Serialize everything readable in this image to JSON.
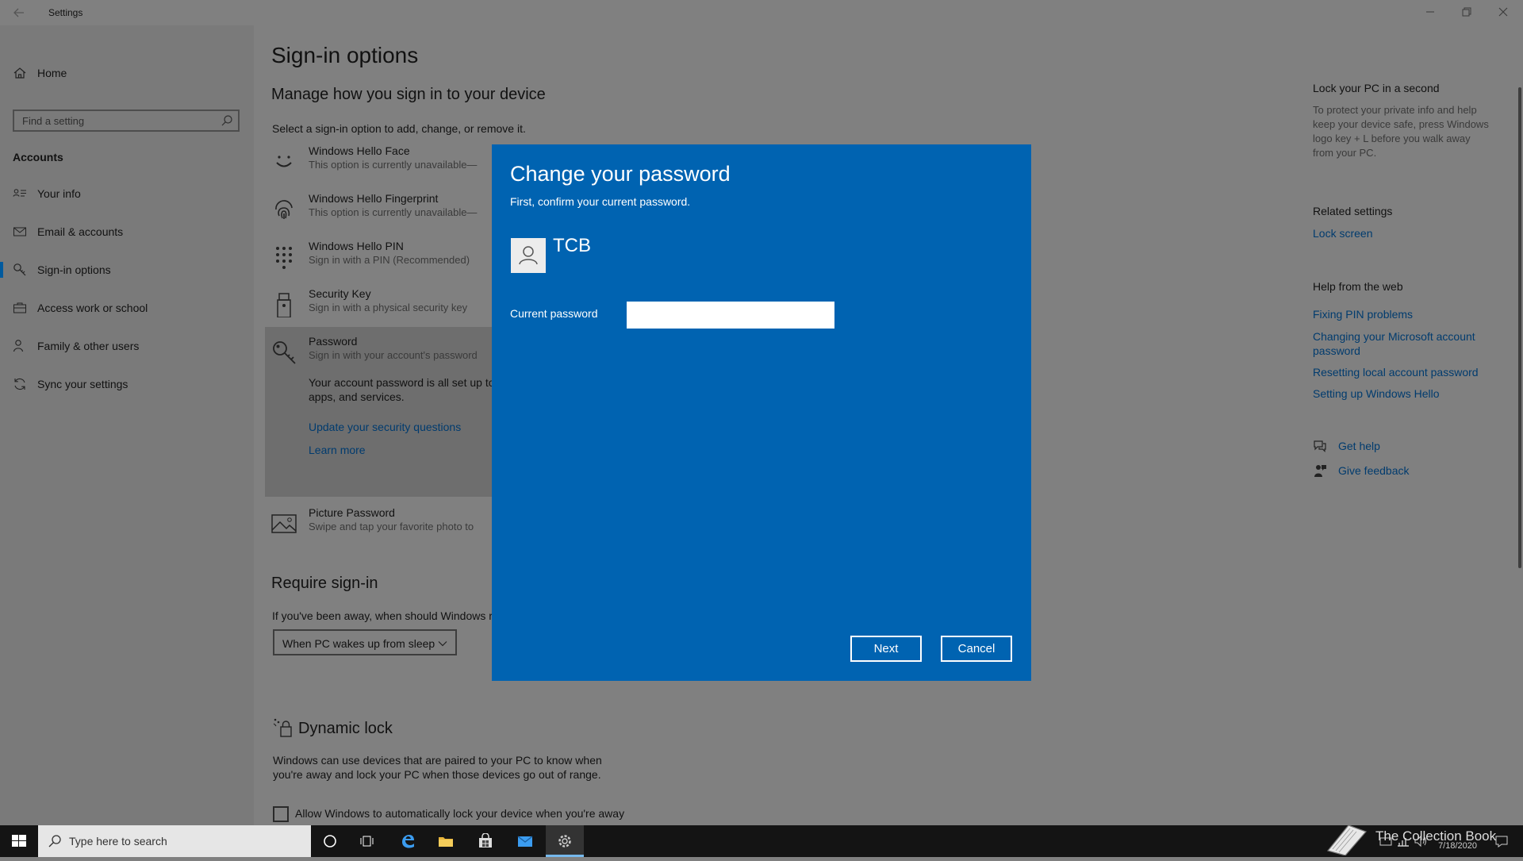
{
  "window": {
    "title": "Settings"
  },
  "sidebar": {
    "home_label": "Home",
    "search_placeholder": "Find a setting",
    "section_label": "Accounts",
    "items": [
      {
        "label": "Your info",
        "icon": "person-card-icon"
      },
      {
        "label": "Email & accounts",
        "icon": "mail-icon"
      },
      {
        "label": "Sign-in options",
        "icon": "key-icon",
        "active": true
      },
      {
        "label": "Access work or school",
        "icon": "briefcase-icon"
      },
      {
        "label": "Family & other users",
        "icon": "people-icon"
      },
      {
        "label": "Sync your settings",
        "icon": "sync-icon"
      }
    ]
  },
  "main": {
    "page_title": "Sign-in options",
    "heading": "Manage how you sign in to your device",
    "intro": "Select a sign-in option to add, change, or remove it.",
    "options": [
      {
        "title": "Windows Hello Face",
        "subtitle": "This option is currently unavailable—"
      },
      {
        "title": "Windows Hello Fingerprint",
        "subtitle": "This option is currently unavailable—"
      },
      {
        "title": "Windows Hello PIN",
        "subtitle": "Sign in with a PIN (Recommended)"
      },
      {
        "title": "Security Key",
        "subtitle": "Sign in with a physical security key"
      },
      {
        "title": "Password",
        "subtitle": "Sign in with your account's password"
      }
    ],
    "password_detail_1": "Your account password is all set up to",
    "password_detail_2": "apps, and services.",
    "update_questions_link": "Update your security questions",
    "learn_more_link": "Learn more",
    "picture_password": {
      "title": "Picture Password",
      "subtitle": "Swipe and tap your favorite photo to"
    },
    "require_signin_heading": "Require sign-in",
    "require_signin_text": "If you've been away, when should Windows r",
    "require_signin_value": "When PC wakes up from sleep",
    "dynamic_lock_heading": "Dynamic lock",
    "dynamic_lock_text_1": "Windows can use devices that are paired to your PC to know when",
    "dynamic_lock_text_2": "you're away and lock your PC when those devices go out of range.",
    "dynamic_lock_checkbox": "Allow Windows to automatically lock your device when you're away"
  },
  "right": {
    "lock_title": "Lock your PC in a second",
    "lock_text": [
      "To protect your private info and help",
      "keep your device safe, press Windows",
      "logo key + L before you walk away",
      "from your PC."
    ],
    "related_title": "Related settings",
    "related_links": [
      "Lock screen"
    ],
    "help_title": "Help from the web",
    "help_links": [
      "Fixing PIN problems",
      "Changing your Microsoft account",
      "password",
      "Resetting local account password",
      "Setting up Windows Hello"
    ],
    "get_help": "Get help",
    "give_feedback": "Give feedback"
  },
  "dialog": {
    "title": "Change your password",
    "subtitle": "First, confirm your current password.",
    "username": "TCB",
    "password_label": "Current password",
    "password_value": "",
    "next_label": "Next",
    "cancel_label": "Cancel",
    "accent_color": "#0063b1"
  },
  "taskbar": {
    "search_placeholder": "Type here to search",
    "clock_date": "7/18/2020"
  },
  "watermark": {
    "text": "The Collection Book"
  }
}
